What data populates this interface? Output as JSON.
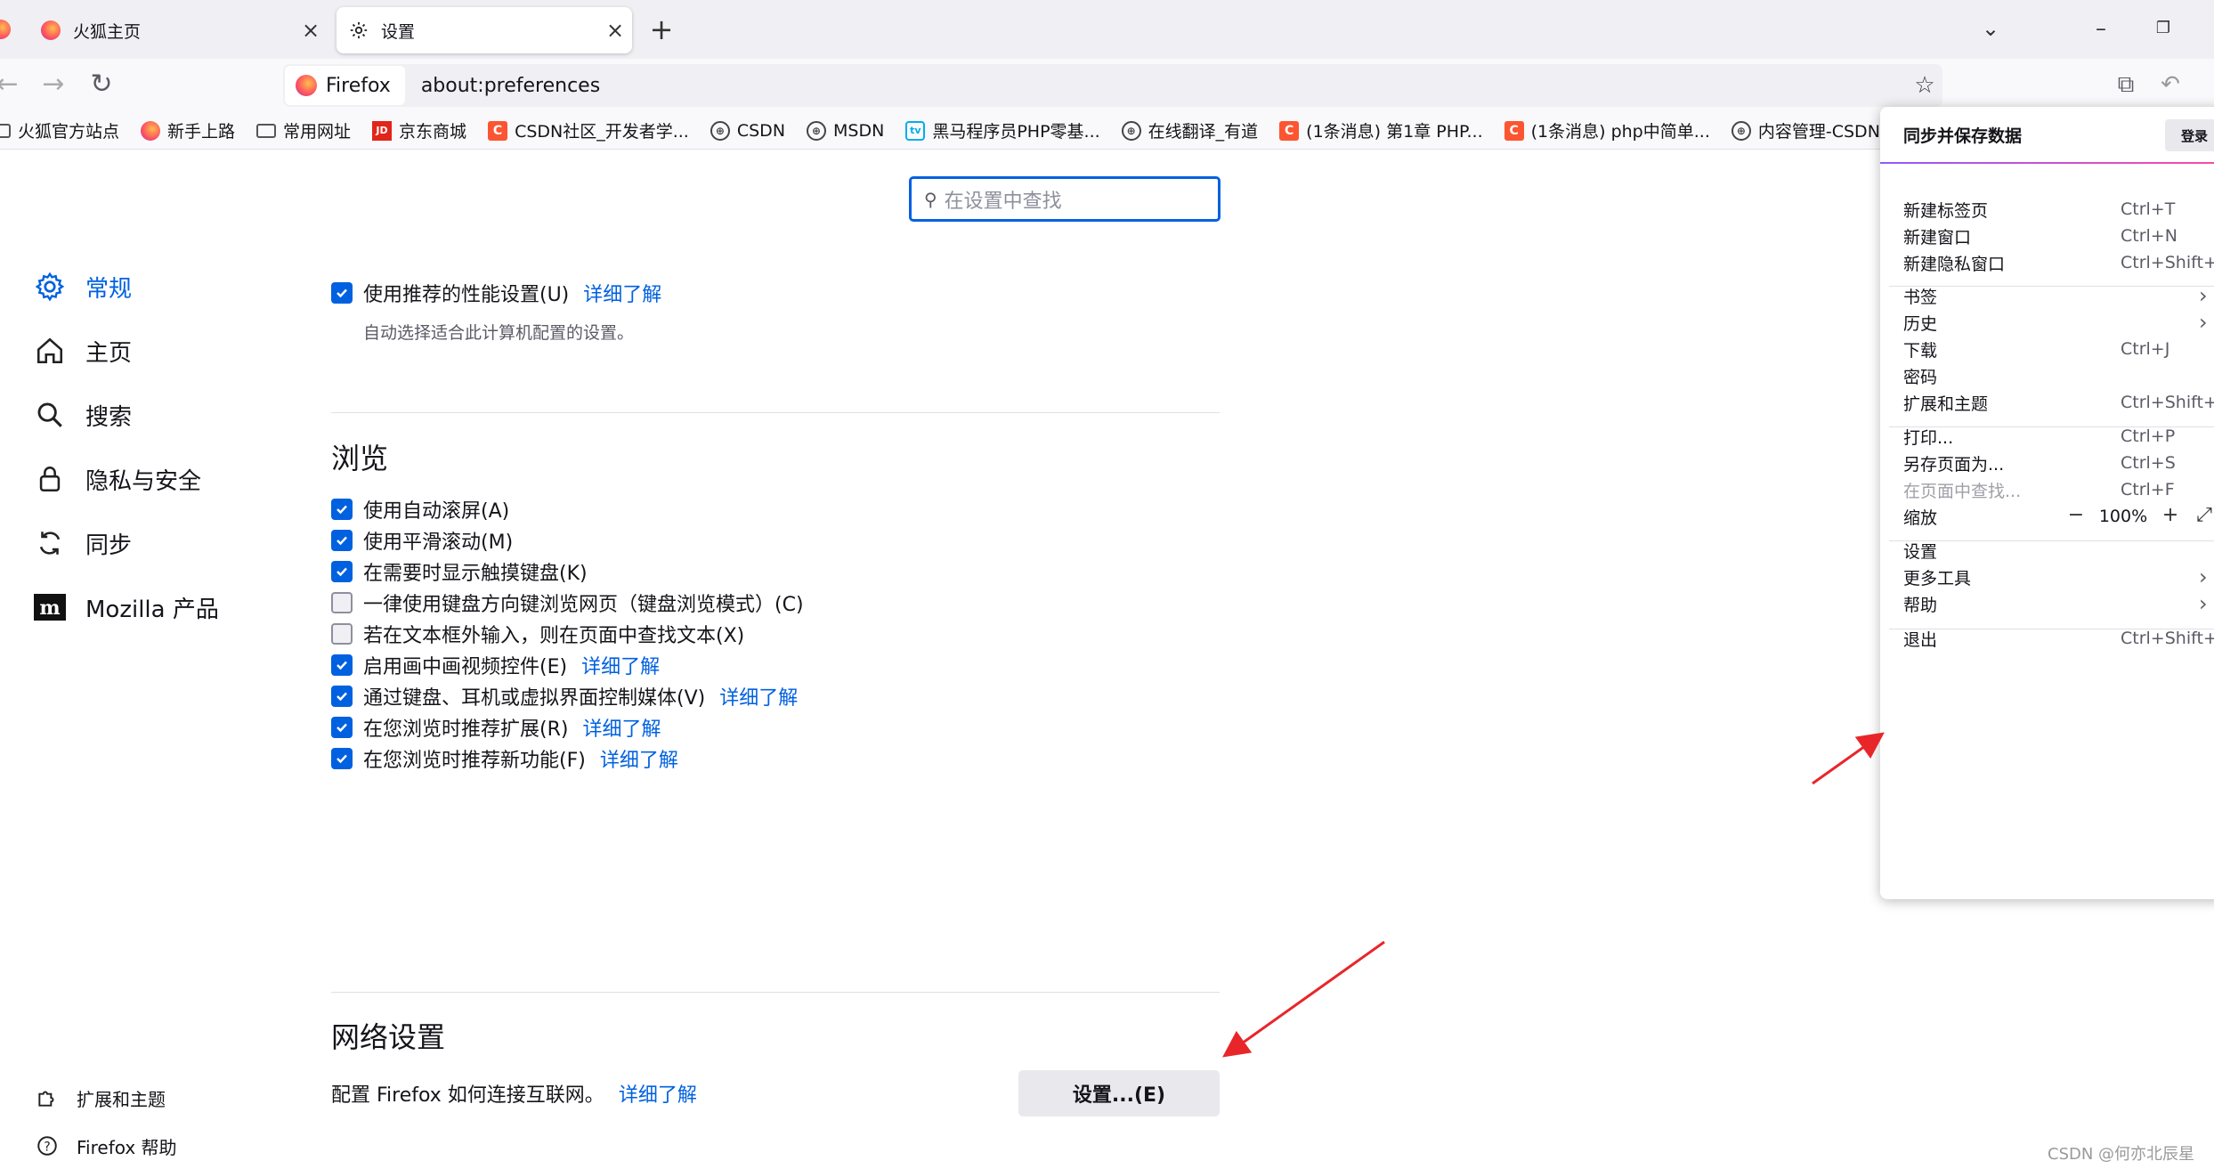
{
  "tabs": [
    {
      "label": "火狐主页"
    },
    {
      "label": "设置"
    }
  ],
  "nav": {
    "identity": "Firefox",
    "url": "about:preferences"
  },
  "bookmarks": [
    {
      "label": "火狐官方站点",
      "icon": "folder-icon"
    },
    {
      "label": "新手上路",
      "icon": "firefox-icon"
    },
    {
      "label": "常用网址",
      "icon": "folder-icon"
    },
    {
      "label": "京东商城",
      "icon": "jd-icon"
    },
    {
      "label": "CSDN社区_开发者学...",
      "icon": "csdn-icon"
    },
    {
      "label": "CSDN",
      "icon": "globe-icon"
    },
    {
      "label": "MSDN",
      "icon": "globe-icon"
    },
    {
      "label": "黑马程序员PHP零基...",
      "icon": "bilibili-icon"
    },
    {
      "label": "在线翻译_有道",
      "icon": "globe-icon"
    },
    {
      "label": "(1条消息) 第1章 PHP...",
      "icon": "csdn-icon"
    },
    {
      "label": "(1条消息) php中简单...",
      "icon": "csdn-icon"
    },
    {
      "label": "内容管理-CSDN创作...",
      "icon": "globe-icon"
    }
  ],
  "search": {
    "placeholder": "在设置中查找"
  },
  "categories": [
    {
      "label": "常规",
      "icon": "gear-icon",
      "active": true
    },
    {
      "label": "主页",
      "icon": "home-icon"
    },
    {
      "label": "搜索",
      "icon": "search-icon"
    },
    {
      "label": "隐私与安全",
      "icon": "lock-icon"
    },
    {
      "label": "同步",
      "icon": "sync-icon"
    },
    {
      "label": "Mozilla 产品",
      "icon": "mozilla-icon"
    }
  ],
  "bottom_links": {
    "extensions": "扩展和主题",
    "help": "Firefox 帮助"
  },
  "performance": {
    "label": "使用推荐的性能设置(U)",
    "link": "详细了解",
    "description": "自动选择适合此计算机配置的设置。",
    "checked": true
  },
  "browsing": {
    "heading": "浏览",
    "options": [
      {
        "label": "使用自动滚屏(A)",
        "checked": true,
        "link": ""
      },
      {
        "label": "使用平滑滚动(M)",
        "checked": true,
        "link": ""
      },
      {
        "label": "在需要时显示触摸键盘(K)",
        "checked": true,
        "link": ""
      },
      {
        "label": "一律使用键盘方向键浏览网页（键盘浏览模式）(C)",
        "checked": false,
        "link": ""
      },
      {
        "label": "若在文本框外输入，则在页面中查找文本(X)",
        "checked": false,
        "link": ""
      },
      {
        "label": "启用画中画视频控件(E)",
        "checked": true,
        "link": "详细了解"
      },
      {
        "label": "通过键盘、耳机或虚拟界面控制媒体(V)",
        "checked": true,
        "link": "详细了解"
      },
      {
        "label": "在您浏览时推荐扩展(R)",
        "checked": true,
        "link": "详细了解"
      },
      {
        "label": "在您浏览时推荐新功能(F)",
        "checked": true,
        "link": "详细了解"
      }
    ]
  },
  "network": {
    "heading": "网络设置",
    "text": "配置 Firefox 如何连接互联网。",
    "link": "详细了解",
    "button": "设置...(E)"
  },
  "app_menu": {
    "sync_title": "同步并保存数据",
    "login": "登录",
    "items": [
      {
        "label": "新建标签页",
        "shortcut": "Ctrl+T"
      },
      {
        "label": "新建窗口",
        "shortcut": "Ctrl+N"
      },
      {
        "label": "新建隐私窗口",
        "shortcut": "Ctrl+Shift+P"
      },
      {
        "label": "书签",
        "submenu": true
      },
      {
        "label": "历史",
        "submenu": true
      },
      {
        "label": "下载",
        "shortcut": "Ctrl+J"
      },
      {
        "label": "密码"
      },
      {
        "label": "扩展和主题",
        "shortcut": "Ctrl+Shift+A"
      },
      {
        "label": "打印...",
        "shortcut": "Ctrl+P"
      },
      {
        "label": "另存页面为...",
        "shortcut": "Ctrl+S"
      },
      {
        "label": "在页面中查找...",
        "shortcut": "Ctrl+F",
        "disabled": true
      },
      {
        "label": "缩放",
        "zoom": "100%"
      },
      {
        "label": "设置"
      },
      {
        "label": "更多工具",
        "submenu": true
      },
      {
        "label": "帮助",
        "submenu": true
      },
      {
        "label": "退出",
        "shortcut": "Ctrl+Shift+Q"
      }
    ]
  },
  "watermark": "CSDN @何亦北辰星",
  "colors": {
    "accent": "#0061e0",
    "annotation_arrow": "#e8262a"
  }
}
